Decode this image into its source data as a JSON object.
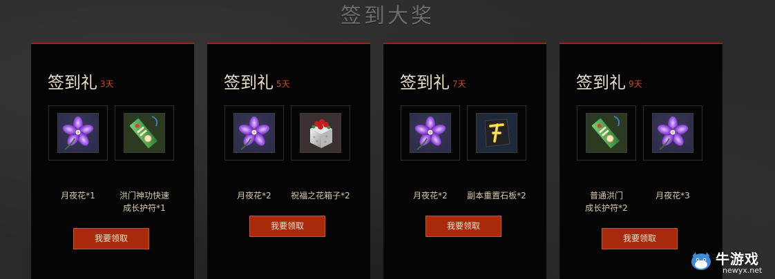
{
  "page": {
    "title": "签到大奖"
  },
  "cards": [
    {
      "title": "签到礼",
      "days": "3天",
      "rewards": [
        {
          "icon": "moonflower-icon",
          "label": "月夜花*1"
        },
        {
          "icon": "green-talisman-icon",
          "label": "洪门神功快速\n成长护符*1"
        }
      ],
      "button": "我要领取"
    },
    {
      "title": "签到礼",
      "days": "5天",
      "rewards": [
        {
          "icon": "moonflower-icon",
          "label": "月夜花*2"
        },
        {
          "icon": "flower-box-icon",
          "label": "祝福之花箱子*2"
        }
      ],
      "button": "我要领取"
    },
    {
      "title": "签到礼",
      "days": "7天",
      "rewards": [
        {
          "icon": "moonflower-icon",
          "label": "月夜花*2"
        },
        {
          "icon": "dungeon-reset-slate-icon",
          "label": "副本重置石板*2"
        }
      ],
      "button": "我要领取"
    },
    {
      "title": "签到礼",
      "days": "9天",
      "rewards": [
        {
          "icon": "green-talisman-icon",
          "label": "普通洪门\n成长护符*2"
        },
        {
          "icon": "moonflower-icon",
          "label": "月夜花*3"
        }
      ],
      "button": "我要领取"
    }
  ],
  "watermark": {
    "name": "牛游戏",
    "url": "newyx.net"
  },
  "colors": {
    "accent": "#a92a0a",
    "card_border": "#8f2a12",
    "days": "#c24a22",
    "title": "#e9dcc6",
    "label": "#d8c9ad"
  }
}
